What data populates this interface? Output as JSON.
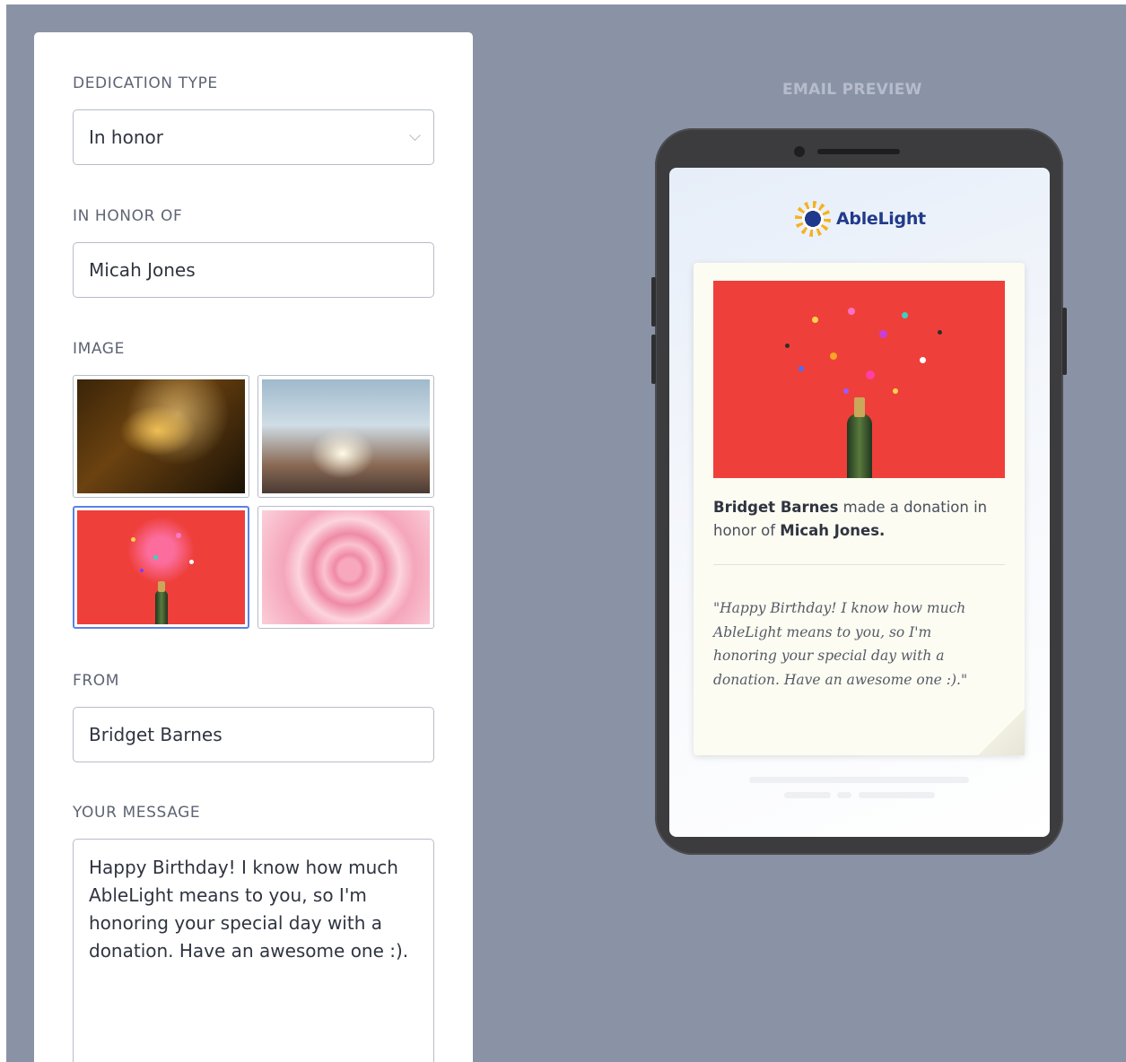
{
  "form": {
    "dedication_type": {
      "label": "DEDICATION TYPE",
      "value": "In honor"
    },
    "in_honor_of": {
      "label": "IN HONOR OF",
      "value": "Micah Jones"
    },
    "image": {
      "label": "IMAGE",
      "options": [
        {
          "name": "candles",
          "selected": false
        },
        {
          "name": "thumbs-up",
          "selected": false
        },
        {
          "name": "champagne-confetti",
          "selected": true
        },
        {
          "name": "pink-rose",
          "selected": false
        }
      ]
    },
    "from": {
      "label": "FROM",
      "value": "Bridget Barnes"
    },
    "message": {
      "label": "YOUR MESSAGE",
      "value": "Happy Birthday! I know how much AbleLight means to you, so I'm honoring your special day with a donation. Have an awesome one :)."
    }
  },
  "preview": {
    "title": "EMAIL PREVIEW",
    "brand": "AbleLight",
    "donor": "Bridget Barnes",
    "donation_mid": "made a donation in honor of",
    "honoree": "Micah Jones.",
    "quote": "\"Happy Birthday! I know how much AbleLight means to you, so I'm honoring your special day with a donation. Have an awesome one :).\""
  },
  "colors": {
    "backdrop": "#8a93a6",
    "selected_border": "#5a82e6",
    "brand_blue": "#213a8a",
    "brand_yellow": "#f4b320",
    "card_red": "#ef3f3a"
  }
}
